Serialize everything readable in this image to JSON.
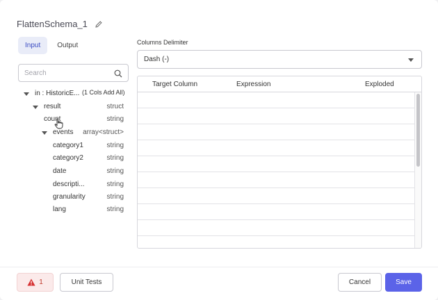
{
  "header": {
    "title": "FlattenSchema_1",
    "edit_icon": "pencil-icon"
  },
  "tabs": [
    {
      "label": "Input",
      "active": true
    },
    {
      "label": "Output",
      "active": false
    }
  ],
  "search": {
    "placeholder": "Search",
    "icon": "search-icon"
  },
  "tree": {
    "root": {
      "name": "in : HistoricE...",
      "add_label": "(1 Cols Add All)"
    },
    "nodes": [
      {
        "name": "result",
        "type": "struct"
      },
      {
        "name": "count",
        "type": "string"
      },
      {
        "name": "events",
        "type": "array<struct>"
      },
      {
        "name": "category1",
        "type": "string"
      },
      {
        "name": "category2",
        "type": "string"
      },
      {
        "name": "date",
        "type": "string"
      },
      {
        "name": "descripti...",
        "type": "string"
      },
      {
        "name": "granularity",
        "type": "string"
      },
      {
        "name": "lang",
        "type": "string"
      }
    ]
  },
  "delimiter": {
    "label": "Columns Delimiter",
    "value": "Dash (-)"
  },
  "grid": {
    "columns": [
      "Target Column",
      "Expression",
      "Exploded"
    ]
  },
  "footer": {
    "error_count": "1",
    "unit_tests_label": "Unit Tests",
    "cancel_label": "Cancel",
    "save_label": "Save"
  },
  "colors": {
    "accent": "#5b63e8",
    "error_bg": "#fbeaea",
    "error_text": "#c0392b"
  }
}
